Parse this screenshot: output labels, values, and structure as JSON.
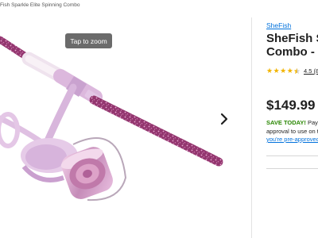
{
  "breadcrumb": "Fish Sparkle Elite Spinning Combo",
  "gallery": {
    "zoom_label": "Tap to zoom",
    "next_icon": "chevron-right-icon"
  },
  "product": {
    "brand": "SheFish",
    "title_line1": "SheFish Sp",
    "title_line2": "Combo - La",
    "rating_value": "4.5",
    "rating_count_partial": "(8",
    "stars": 4.5,
    "price": "$149.99",
    "promo_save": "SAVE TODAY!",
    "promo_rest": " Pay $12",
    "promo_line2": "approval to use on to",
    "promo_link": "you're pre-approved"
  },
  "colors": {
    "brand_link": "#0071dc",
    "save_green": "#2a8703",
    "star_gold": "#f2b400",
    "rod_purple": "#a0467f"
  }
}
